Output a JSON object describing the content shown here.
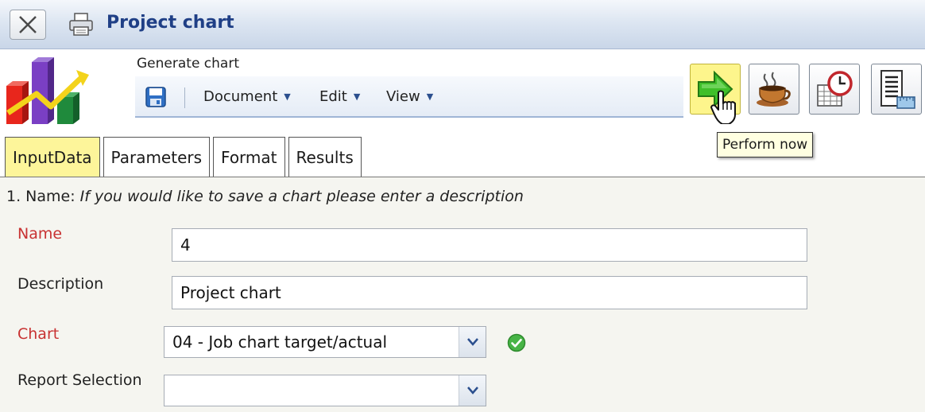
{
  "window": {
    "title": "Project chart"
  },
  "header": {
    "generate_label": "Generate chart"
  },
  "toolbar": {
    "menus": [
      {
        "label": "Document"
      },
      {
        "label": "Edit"
      },
      {
        "label": "View"
      }
    ]
  },
  "actions": {
    "tooltip": "Perform now"
  },
  "tabs": [
    {
      "label": "InputData",
      "active": true
    },
    {
      "label": "Parameters"
    },
    {
      "label": "Format"
    },
    {
      "label": "Results"
    }
  ],
  "form": {
    "instruction_prefix": "1. Name: ",
    "instruction_text": "If you would like to save a chart please enter a description",
    "fields": {
      "name": {
        "label": "Name",
        "value": "4"
      },
      "description": {
        "label": "Description",
        "value": "Project chart"
      },
      "chart": {
        "label": "Chart",
        "value": "04 - Job chart target/actual"
      },
      "report_selection": {
        "label": "Report Selection",
        "value": ""
      }
    }
  },
  "colors": {
    "required_label": "#c83232",
    "active_tab": "#fdf59a",
    "title_text": "#1f3f86"
  }
}
